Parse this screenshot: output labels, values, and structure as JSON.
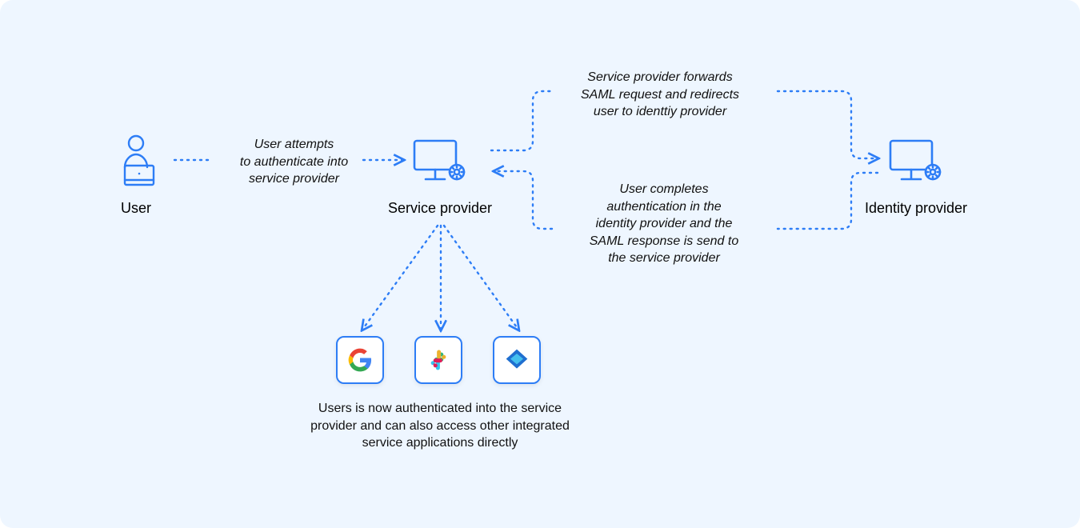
{
  "colors": {
    "accent": "#2d7df6",
    "bg": "#eef6ff",
    "text": "#0a0a0a"
  },
  "nodes": {
    "user": {
      "label": "User"
    },
    "service_provider": {
      "label": "Service provider"
    },
    "identity_provider": {
      "label": "Identity provider"
    }
  },
  "flows": {
    "user_to_sp": "User attempts\nto authenticate into\nservice provider",
    "sp_to_idp": "Service provider forwards\nSAML request and redirects\nuser to identtiy provider",
    "idp_to_sp": "User completes\nauthentication in the\nidentity provider and the\nSAML response is send to\nthe service provider"
  },
  "result": {
    "text": "Users is now authenticated into the service\nprovider and can also access other integrated\nservice applications directly"
  },
  "apps": {
    "google": "Google",
    "slack": "Slack",
    "azure": "Azure AD"
  }
}
